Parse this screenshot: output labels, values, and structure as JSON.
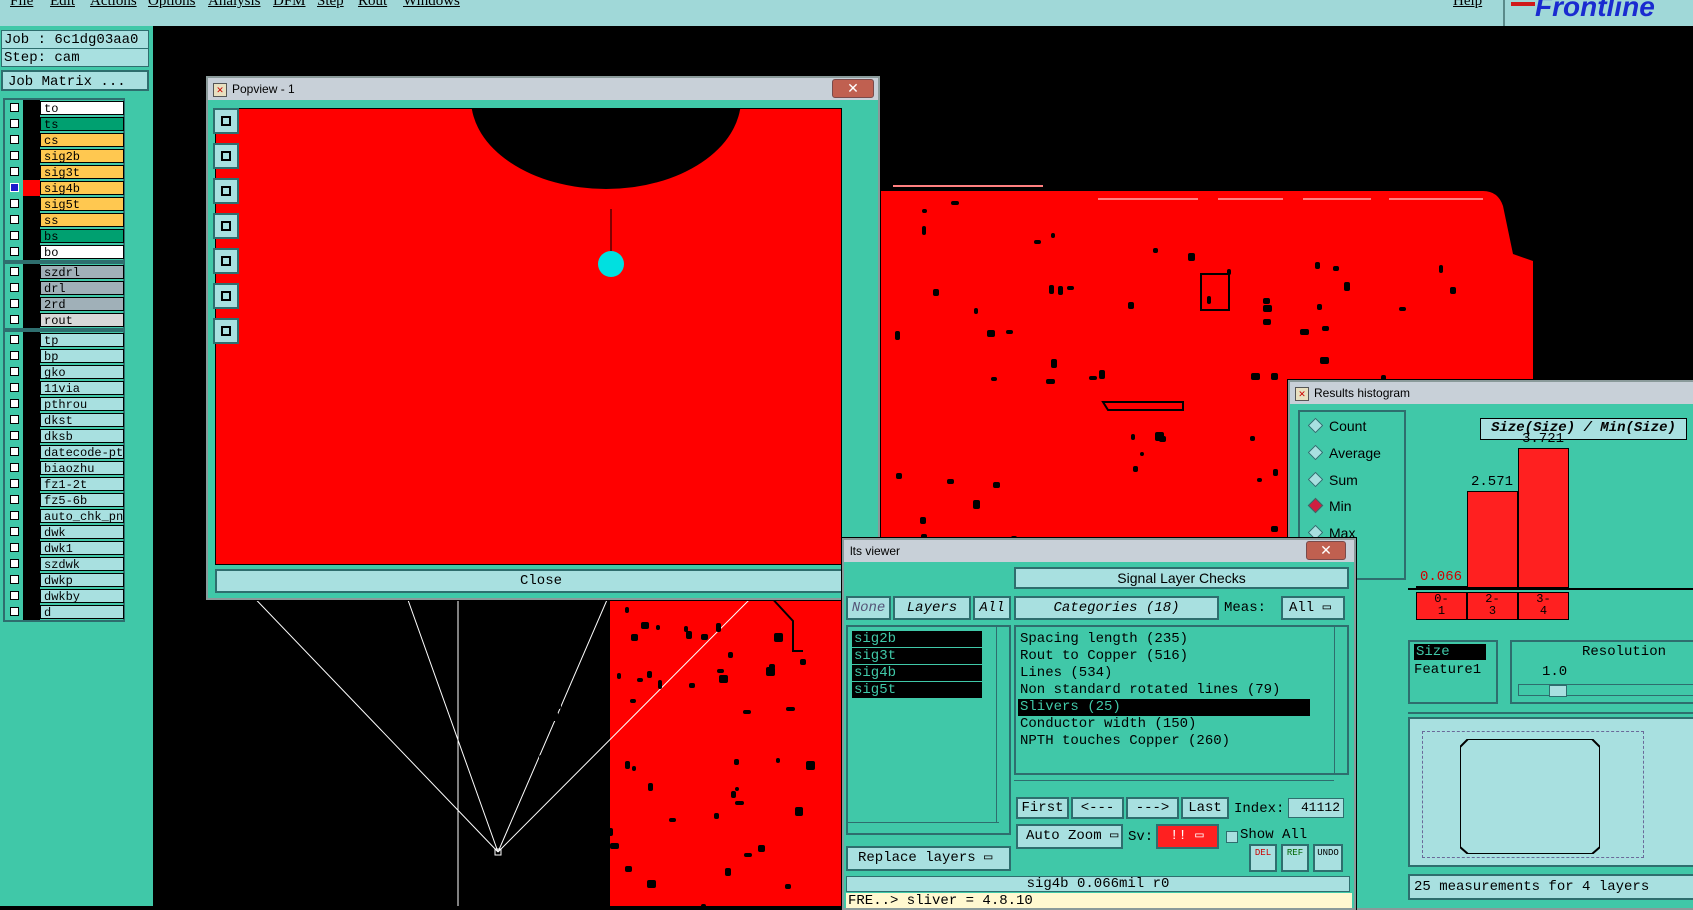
{
  "menu": [
    "File",
    "Edit",
    "Actions",
    "Options",
    "Analysis",
    "DFM",
    "Step",
    "Rout",
    "Windows"
  ],
  "help_label": "Help",
  "brand": "Frontline",
  "job_label": "Job : 6c1dg03aa0",
  "step_label": "Step: cam",
  "job_matrix_button": "Job Matrix ...",
  "layers_board": [
    {
      "name": "to",
      "color": "#ffffff"
    },
    {
      "name": "ts",
      "color": "#00a070"
    },
    {
      "name": "cs",
      "color": "#ffc850"
    },
    {
      "name": "sig2b",
      "color": "#ffc850"
    },
    {
      "name": "sig3t",
      "color": "#ffc850"
    },
    {
      "name": "sig4b",
      "color": "#ffc850"
    },
    {
      "name": "sig5t",
      "color": "#ffc850"
    },
    {
      "name": "ss",
      "color": "#ffc850"
    },
    {
      "name": "bs",
      "color": "#00a070"
    },
    {
      "name": "bo",
      "color": "#ffffff"
    }
  ],
  "layers_drill": [
    {
      "name": "szdrl",
      "color": "#a0b0b8"
    },
    {
      "name": "drl",
      "color": "#a0b0b8"
    },
    {
      "name": "2rd",
      "color": "#a0b0b8"
    },
    {
      "name": "rout",
      "color": "#d8d8d8"
    }
  ],
  "layers_misc": [
    "tp",
    "bp",
    "gko",
    "11via",
    "pthrou",
    "dkst",
    "dksb",
    "datecode-ptc",
    "biaozhu",
    "fz1-2t",
    "fz5-6b",
    "auto_chk_pnl",
    "dwk",
    "dwk1",
    "szdwk",
    "dwkp",
    "dwkby",
    "d"
  ],
  "popview": {
    "title": "Popview - 1",
    "close_label": "Close"
  },
  "results_viewer": {
    "title": "lts viewer",
    "header": "Signal Layer Checks",
    "none_label": "None",
    "layers_label": "Layers",
    "all_label": "All",
    "categories_label": "Categories (18)",
    "meas_label": "Meas:",
    "meas_value": "All",
    "layers": [
      "sig2b",
      "sig3t",
      "sig4b",
      "sig5t"
    ],
    "categories": [
      "Spacing length (235)",
      "Rout to Copper (516)",
      "Lines (534)",
      "Non standard rotated lines (79)",
      "Slivers (25)",
      "Conductor width (150)",
      "NPTH touches Copper (260)"
    ],
    "selected_category_index": 4,
    "first_label": "First",
    "prev_label": "<---",
    "next_label": "--->",
    "last_label": "Last",
    "index_label": "Index:",
    "index_value": "41112",
    "auto_zoom_label": "Auto Zoom",
    "sv_label": "Sv:",
    "sv_value": "!!",
    "show_all_label": "Show All",
    "replace_layers_label": "Replace layers",
    "del_label": "DEL",
    "ref_label": "REF",
    "undo_label": "UNDO",
    "status": "sig4b 0.066mil  r0",
    "log_line": "FRE..> sliver = 4.8.10"
  },
  "histogram": {
    "title": "Results histogram",
    "chart_title": "Size(Size) / Min(Size)",
    "radios": [
      "Count",
      "Average",
      "Sum",
      "Min",
      "Max"
    ],
    "selected_radio": "Min",
    "bars": [
      {
        "label": "0-\n1",
        "value": 0.066,
        "text": "0.066"
      },
      {
        "label": "2-\n3",
        "value": 2.571,
        "text": "2.571"
      },
      {
        "label": "3-\n4",
        "value": 3.721,
        "text": "3.721"
      }
    ],
    "x_list": [
      "Size",
      "Feature1"
    ],
    "resolution_label": "Resolution",
    "resolution_value": "1.0",
    "summary": "25 measurements for 4 layers"
  }
}
